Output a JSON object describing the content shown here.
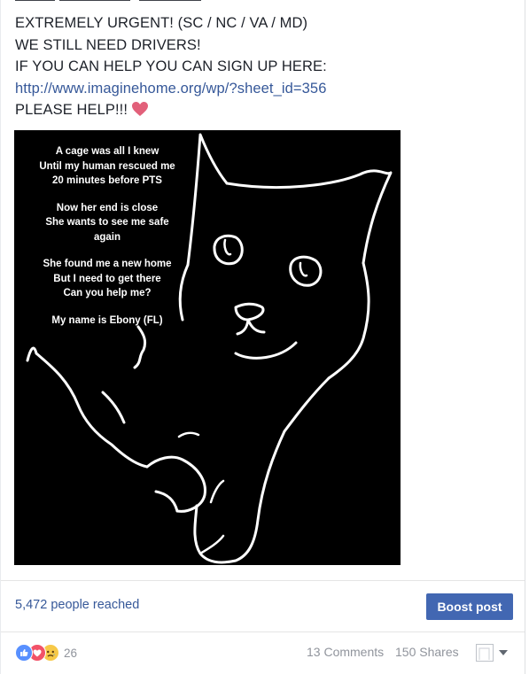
{
  "post": {
    "lines": [
      "EXTREMELY URGENT! (SC / NC / VA / MD)",
      "WE STILL NEED DRIVERS!",
      "IF YOU CAN HELP YOU CAN SIGN UP HERE:"
    ],
    "link": "http://www.imaginehome.org/wp/?sheet_id=356",
    "closing": "PLEASE HELP!!!",
    "heart_icon": "heart-emoji-icon",
    "heart_color": "#e2607a"
  },
  "photo": {
    "poem": [
      [
        "A cage was all I knew",
        "Until my human rescued me",
        "20 minutes before PTS"
      ],
      [
        "Now her end is close",
        "She wants to see me safe",
        "again"
      ],
      [
        "She found me a new home",
        "But I need to get there",
        "Can you help me?"
      ],
      [
        "My name is Ebony (FL)"
      ]
    ]
  },
  "footer": {
    "reach": "5,472 people reached",
    "boost_label": "Boost post",
    "accent": "#4267b2",
    "reaction_icons": [
      "like-icon",
      "love-icon",
      "sad-icon"
    ],
    "reaction_count": "26",
    "comments": "13 Comments",
    "shares": "150 Shares"
  }
}
